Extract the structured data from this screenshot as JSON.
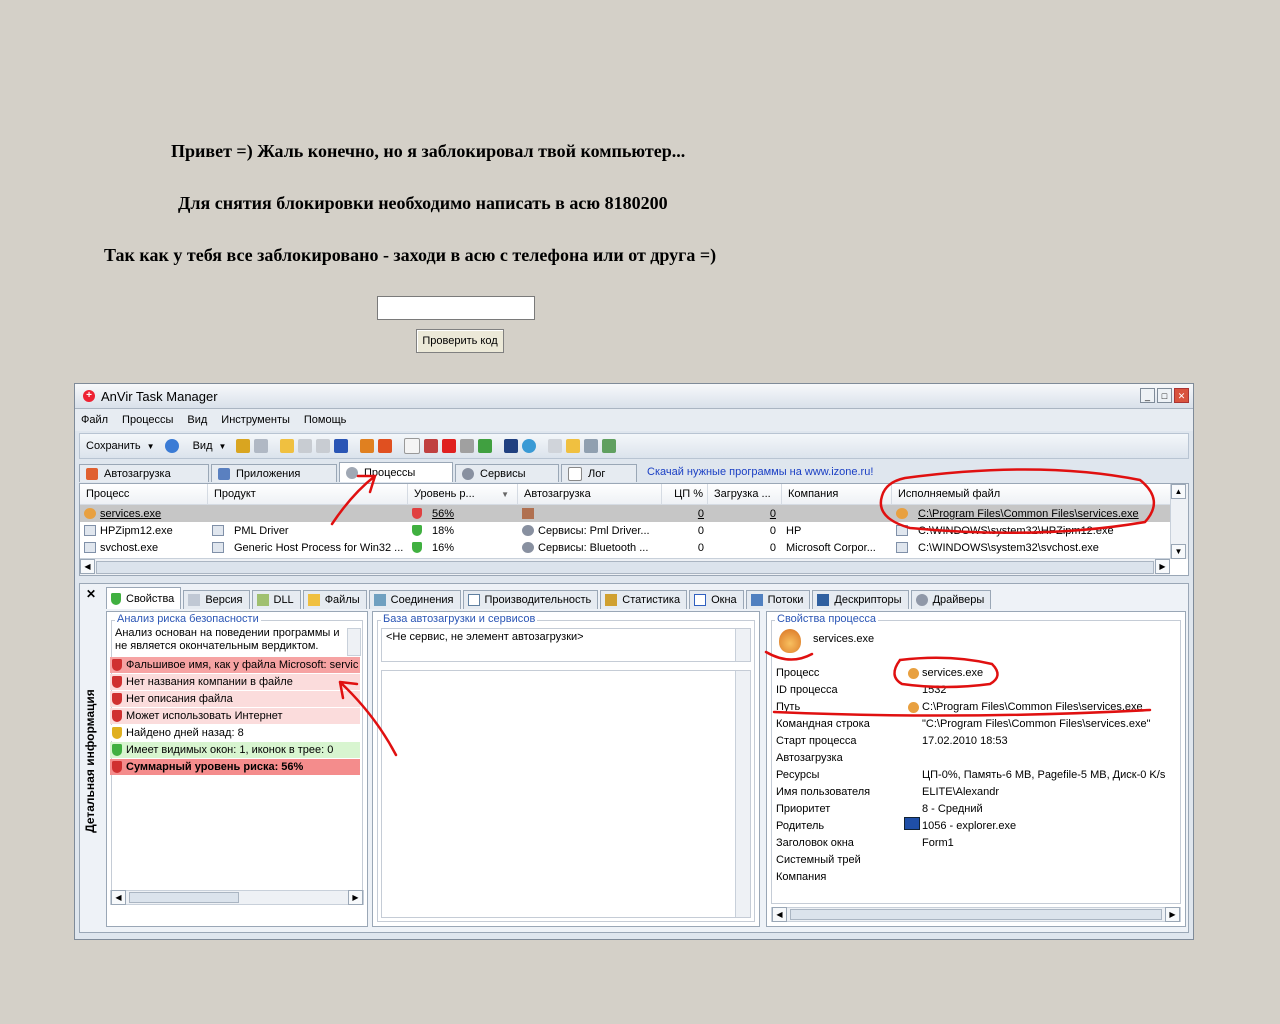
{
  "lock_screen": {
    "line1": "Привет =) Жаль конечно, но я заблокировал твой компьютер...",
    "line2": "Для снятия блокировки необходимо написать в асю 8180200",
    "line3": "Так как у тебя все заблокировано - заходи в асю с телефона или от друга =)",
    "input_value": "",
    "check_button": "Проверить код"
  },
  "window": {
    "title": "AnVir Task Manager",
    "menu": [
      "Файл",
      "Процессы",
      "Вид",
      "Инструменты",
      "Помощь"
    ],
    "toolbar": {
      "save": "Сохранить",
      "view": "Вид"
    },
    "tabs": [
      "Автозагрузка",
      "Приложения",
      "Процессы",
      "Сервисы",
      "Лог"
    ],
    "active_tab": "Процессы",
    "link": "Скачай нужные программы на www.izone.ru!"
  },
  "grid": {
    "columns": [
      "Процесс",
      "Продукт",
      "Уровень р...",
      "Автозагрузка",
      "ЦП %",
      "Загрузка ...",
      "Компания",
      "Исполняемый файл"
    ],
    "rows": [
      {
        "process": "services.exe",
        "product": "",
        "risk": "56%",
        "autorun": "",
        "cpu": "0",
        "load": "0",
        "company": "",
        "file": "C:\\Program Files\\Common Files\\services.exe"
      },
      {
        "process": "HPZipm12.exe",
        "product": "PML Driver",
        "risk": "18%",
        "autorun": "Сервисы: Pml Driver...",
        "cpu": "0",
        "load": "0",
        "company": "HP",
        "file": "C:\\WINDOWS\\system32\\HPZipm12.exe"
      },
      {
        "process": "svchost.exe",
        "product": "Generic Host Process for Win32 ...",
        "risk": "16%",
        "autorun": "Сервисы: Bluetooth ...",
        "cpu": "0",
        "load": "0",
        "company": "Microsoft Corpor...",
        "file": "C:\\WINDOWS\\system32\\svchost.exe"
      }
    ]
  },
  "details": {
    "vertical_label": "Детальная информация",
    "tabs": [
      "Свойства",
      "Версия",
      "DLL",
      "Файлы",
      "Соединения",
      "Производительность",
      "Статистика",
      "Окна",
      "Потоки",
      "Дескрипторы",
      "Драйверы"
    ],
    "active_tab": "Свойства",
    "risk": {
      "legend": "Анализ риска безопасности",
      "intro": "Анализ основан на поведении программы и не является окончательным вердиктом.",
      "items": [
        {
          "text": "Фальшивое имя, как у файла Microsoft: servic",
          "level": "red"
        },
        {
          "text": "Нет названия компании в файле",
          "level": "light"
        },
        {
          "text": "Нет описания файла",
          "level": "light"
        },
        {
          "text": "Может использовать Интернет",
          "level": "light"
        },
        {
          "text": "Найдено дней назад: 8",
          "level": "yellow"
        },
        {
          "text": "Имеет видимых окон: 1, иконок в трее: 0",
          "level": "green"
        },
        {
          "text": "Суммарный уровень риска: 56%",
          "level": "total"
        }
      ]
    },
    "autorun": {
      "legend": "База автозагрузки и сервисов",
      "text": "<Не сервис, не элемент автозагрузки>"
    },
    "props": {
      "legend": "Свойства процесса",
      "name": "services.exe",
      "labels": [
        "Процесс",
        "ID процесса",
        "Путь",
        "Командная строка",
        "Старт процесса",
        "Автозагрузка",
        "Ресурсы",
        "Имя пользователя",
        "Приоритет",
        "Родитель",
        "Заголовок окна",
        "Системный трей",
        "Компания"
      ],
      "values": [
        "services.exe",
        "1532",
        "C:\\Program Files\\Common Files\\services.exe",
        "\"C:\\Program Files\\Common Files\\services.exe\"",
        "17.02.2010 18:53",
        "",
        "ЦП-0%, Память-6 MB, Pagefile-5 MB, Диск-0 K/s",
        "ELITE\\Alexandr",
        "8 - Средний",
        "1056 - explorer.exe",
        "Form1",
        "",
        ""
      ]
    }
  },
  "colors": {
    "annotation": "#e01010",
    "risk_red": "#f6a3a3",
    "risk_light": "#fbdcdc",
    "risk_green": "#d8f5d0",
    "risk_total": "#f48c8c",
    "link": "#1a3fc4"
  }
}
